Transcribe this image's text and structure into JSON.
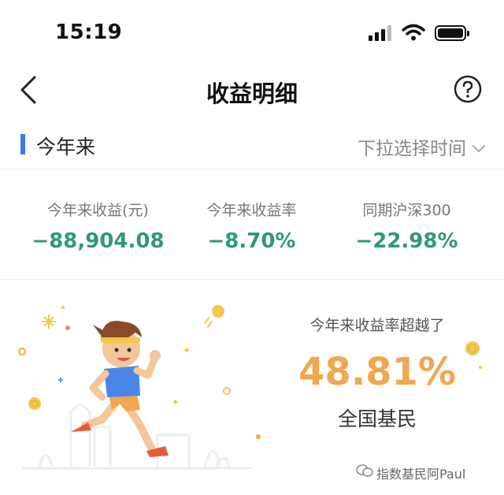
{
  "status_bar": {
    "time": "15:19"
  },
  "nav": {
    "title": "收益明细"
  },
  "period": {
    "label": "今年来",
    "picker_label": "下拉选择时间"
  },
  "stats": [
    {
      "label": "今年来收益(元)",
      "value": "−88,904.08"
    },
    {
      "label": "今年来收益率",
      "value": "−8.70%"
    },
    {
      "label": "同期沪深300",
      "value": "−22.98%"
    }
  ],
  "banner": {
    "beat_label": "今年来收益率超越了",
    "beat_percent": "48.81%",
    "beat_subject": "全国基民"
  },
  "watermark": {
    "text": "指数基民阿Paul"
  },
  "colors": {
    "accent": "#3a7de0",
    "negative": "#2e9a72",
    "highlight": "#f0a850"
  }
}
